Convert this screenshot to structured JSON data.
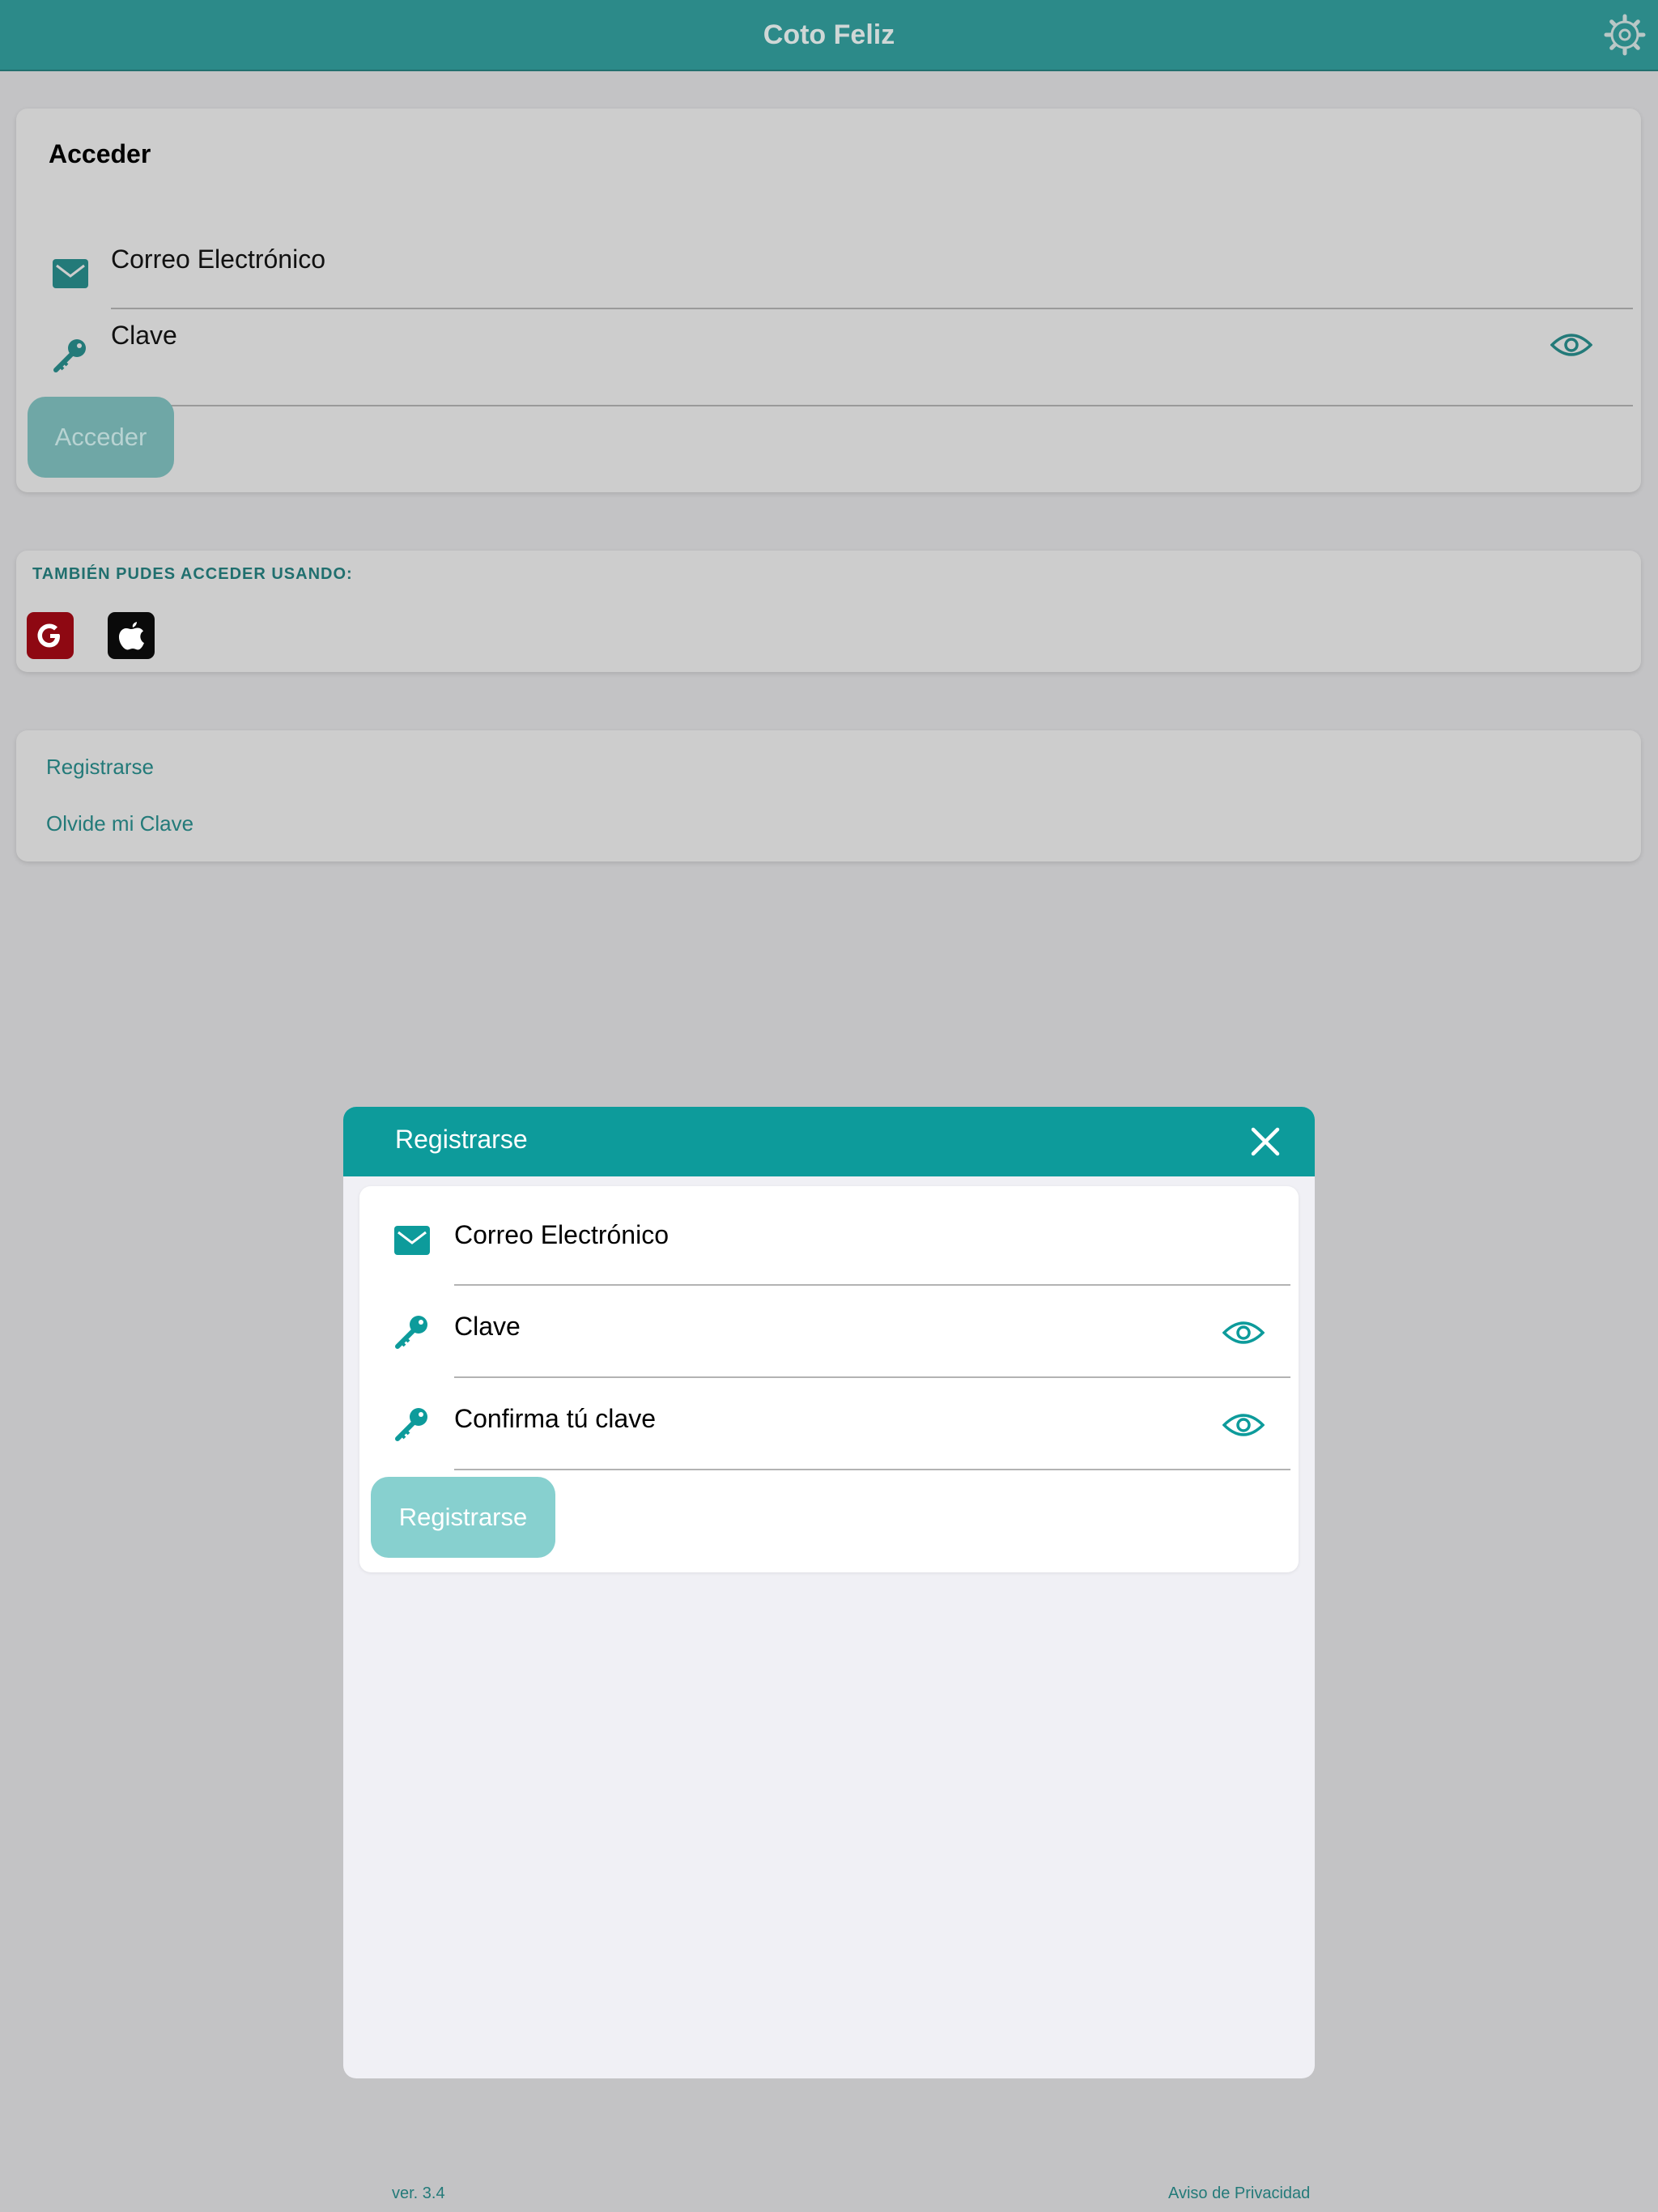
{
  "app": {
    "title": "Coto Feliz"
  },
  "login": {
    "title": "Acceder",
    "email_label": "Correo Electrónico",
    "password_label": "Clave",
    "submit_label": "Acceder"
  },
  "social": {
    "heading": "TAMBIÉN PUDES ACCEDER USANDO:",
    "providers": [
      "google-icon",
      "apple-icon"
    ]
  },
  "links": {
    "register": "Registrarse",
    "forgot": "Olvide mi Clave"
  },
  "modal": {
    "title": "Registrarse",
    "email_label": "Correo Electrónico",
    "password_label": "Clave",
    "confirm_label": "Confirma tú clave",
    "submit_label": "Registrarse"
  },
  "footer": {
    "version": "ver. 3.4",
    "privacy": "Aviso de Privacidad"
  },
  "colors": {
    "accent": "#0d9b9b",
    "topbar": "#2c8a89",
    "overlay_bg": "#c3c3c5",
    "link": "#237a79"
  }
}
